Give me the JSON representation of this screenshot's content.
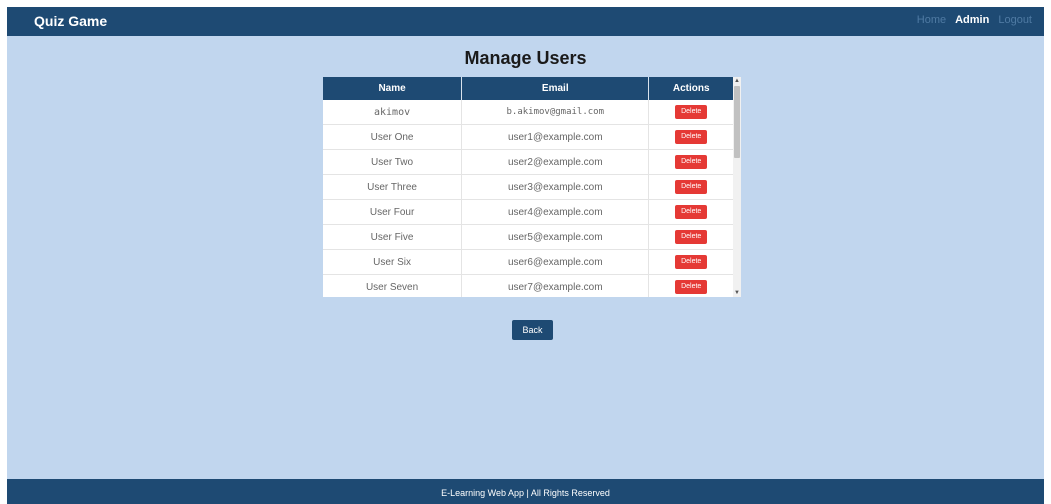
{
  "navbar": {
    "brand": "Quiz Game",
    "links": [
      {
        "label": "Home",
        "active": false
      },
      {
        "label": "Admin",
        "active": true
      },
      {
        "label": "Logout",
        "active": false
      }
    ]
  },
  "page": {
    "title": "Manage Users"
  },
  "table": {
    "headers": [
      "Name",
      "Email",
      "Actions"
    ],
    "rows": [
      {
        "name": "akimov",
        "email": "b.akimov@gmail.com",
        "action": "Delete"
      },
      {
        "name": "User One",
        "email": "user1@example.com",
        "action": "Delete"
      },
      {
        "name": "User Two",
        "email": "user2@example.com",
        "action": "Delete"
      },
      {
        "name": "User Three",
        "email": "user3@example.com",
        "action": "Delete"
      },
      {
        "name": "User Four",
        "email": "user4@example.com",
        "action": "Delete"
      },
      {
        "name": "User Five",
        "email": "user5@example.com",
        "action": "Delete"
      },
      {
        "name": "User Six",
        "email": "user6@example.com",
        "action": "Delete"
      },
      {
        "name": "User Seven",
        "email": "user7@example.com",
        "action": "Delete"
      }
    ]
  },
  "actions": {
    "back_label": "Back"
  },
  "footer": {
    "text": "E-Learning Web App | All Rights Reserved"
  },
  "colors": {
    "navy": "#1e4a73",
    "background": "#c1d6ee",
    "delete": "#e53935"
  }
}
